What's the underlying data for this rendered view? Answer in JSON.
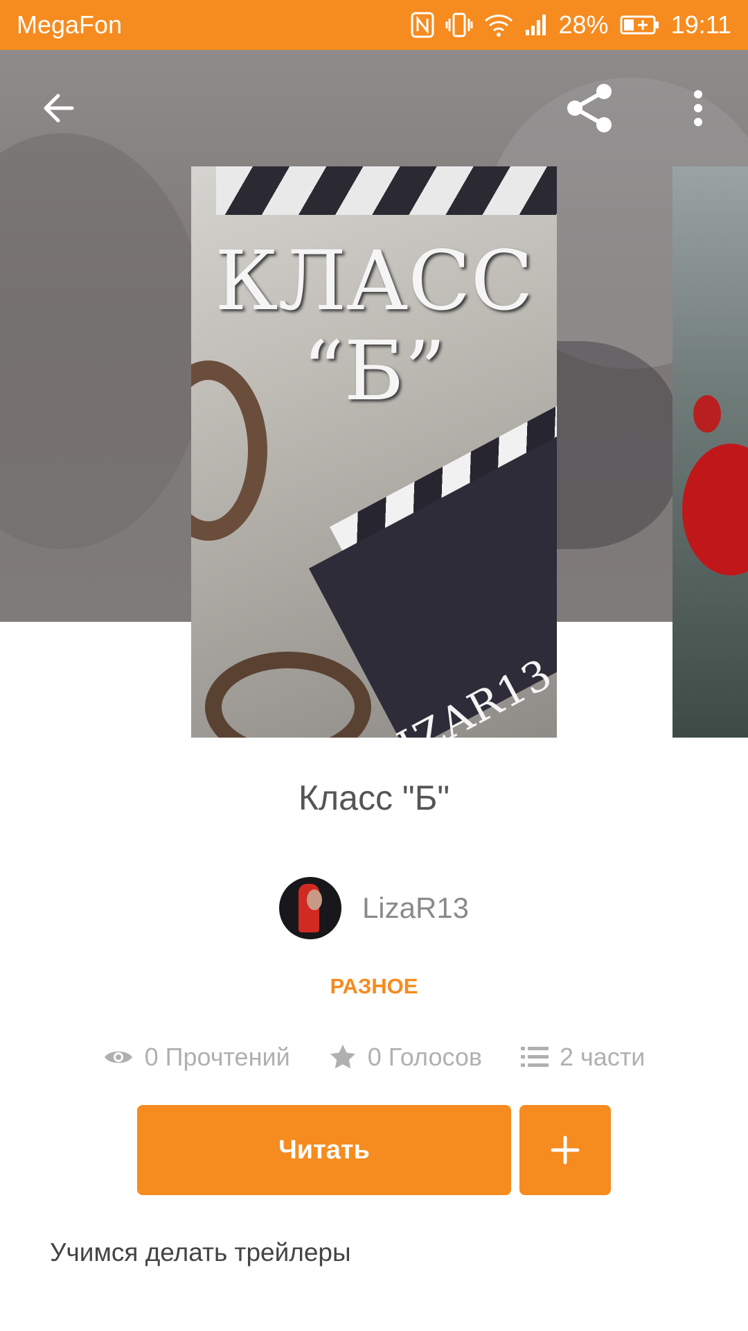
{
  "status_bar": {
    "carrier": "MegaFon",
    "battery": "28%",
    "time": "19:11",
    "icons": [
      "nfc-icon",
      "vibrate-icon",
      "wifi-icon",
      "signal-icon",
      "battery-charging-icon"
    ]
  },
  "toolbar": {
    "back_icon": "arrow-left-icon",
    "share_icon": "share-icon",
    "more_icon": "more-vertical-icon"
  },
  "cover": {
    "title": "КЛАСС “Б”",
    "author": "LIZAR13"
  },
  "book": {
    "title": "Класс \"Б\"",
    "author": "LizaR13",
    "category": "РАЗНОЕ",
    "stats": {
      "reads": "0 Прочтений",
      "votes": "0 Голосов",
      "parts": "2 части"
    },
    "description": "Учимся делать трейлеры"
  },
  "actions": {
    "read_label": "Читать",
    "add_icon": "plus-icon"
  },
  "colors": {
    "accent": "#f68b1f",
    "text_primary": "#555555",
    "text_secondary": "#b0b0b0"
  }
}
